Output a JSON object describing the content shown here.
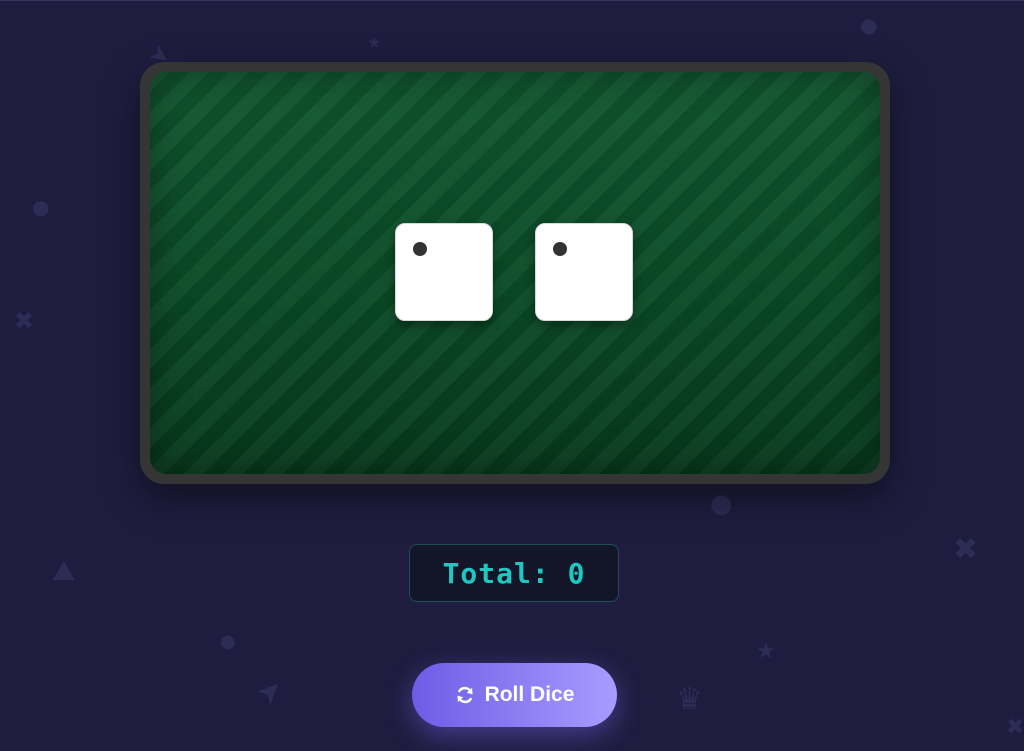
{
  "game": {
    "dice": [
      {
        "value": 1
      },
      {
        "value": 1
      }
    ],
    "total_text": "Total: 0",
    "roll_button_label": "Roll Dice"
  },
  "colors": {
    "background": "#1e1d3f",
    "table_felt": "#0b4d27",
    "table_frame": "#353535",
    "total_text": "#1ec8c1",
    "button_gradient_start": "#6e5ce6",
    "button_gradient_end": "#a99cff"
  },
  "icons": {
    "roll_button_icon": "refresh-icon",
    "background_decorations": [
      "rocket-icon",
      "star-icon",
      "crossed-swords-icon",
      "ghost-icon",
      "crown-icon",
      "ball-icon"
    ]
  }
}
